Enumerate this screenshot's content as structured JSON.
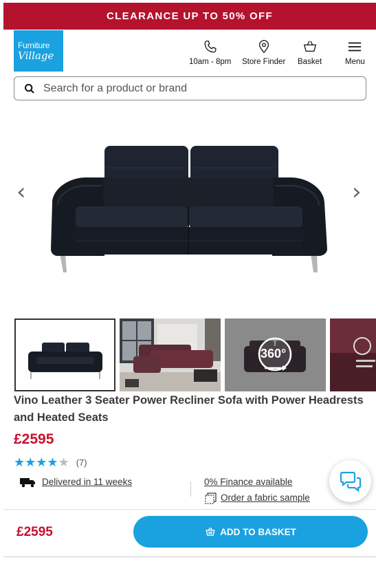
{
  "promo": {
    "text": "CLEARANCE UP TO 50% OFF"
  },
  "logo": {
    "line1": "Furniture",
    "line2": "Village"
  },
  "header": {
    "phone_label": "10am - 8pm",
    "store_label": "Store Finder",
    "basket_label": "Basket",
    "menu_label": "Menu"
  },
  "search": {
    "placeholder": "Search for a product or brand"
  },
  "gallery": {
    "prev": "‹",
    "next": "›"
  },
  "thumbs": {
    "badge_360": "360°"
  },
  "product": {
    "title": "Vino Leather 3 Seater Power Recliner Sofa with Power Headrests and Heated Seats",
    "price": "£2595",
    "rating_value": 4,
    "rating_max": 5,
    "review_count": "(7)"
  },
  "info": {
    "delivery": "Delivered in 11 weeks",
    "finance": "0% Finance available",
    "sample": "Order a fabric sample"
  },
  "bottom_bar": {
    "price": "£2595",
    "button_label": "ADD TO BASKET"
  },
  "colors": {
    "brand_red": "#b5122e",
    "price_red": "#c8102e",
    "brand_blue": "#1aa1e0"
  }
}
